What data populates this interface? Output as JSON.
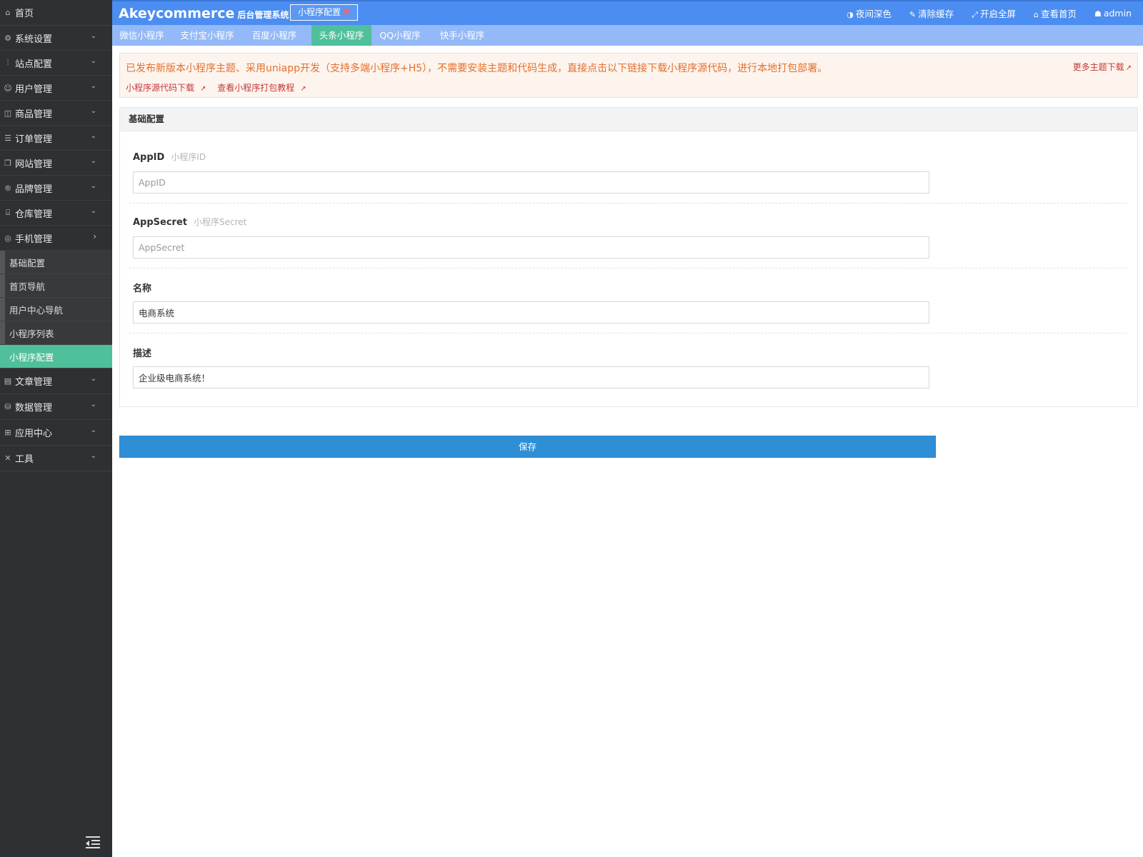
{
  "header": {
    "brand": "Akeycommerce",
    "brand_sub": "后台管理系统",
    "open_tab": "小程序配置",
    "tools": {
      "night": "夜间深色",
      "clear_cache": "清除缓存",
      "fullscreen": "开启全屏",
      "view_home": "查看首页",
      "user": "admin"
    }
  },
  "sidebar": {
    "home": "首页",
    "menu": [
      {
        "label": "系统设置",
        "icon": "gear-icon"
      },
      {
        "label": "站点配置",
        "icon": "sliders-icon"
      },
      {
        "label": "用户管理",
        "icon": "user-icon"
      },
      {
        "label": "商品管理",
        "icon": "bag-icon"
      },
      {
        "label": "订单管理",
        "icon": "list-icon"
      },
      {
        "label": "网站管理",
        "icon": "browser-icon"
      },
      {
        "label": "品牌管理",
        "icon": "registered-icon"
      },
      {
        "label": "仓库管理",
        "icon": "warehouse-icon"
      },
      {
        "label": "手机管理",
        "icon": "mobile-icon"
      }
    ],
    "submenu": [
      "基础配置",
      "首页导航",
      "用户中心导航",
      "小程序列表",
      "小程序配置"
    ],
    "menu_after": [
      {
        "label": "文章管理",
        "icon": "article-icon"
      },
      {
        "label": "数据管理",
        "icon": "database-icon"
      },
      {
        "label": "应用中心",
        "icon": "apps-icon"
      },
      {
        "label": "工具",
        "icon": "tools-icon"
      }
    ]
  },
  "subnav": {
    "tabs": [
      "微信小程序",
      "支付宝小程序",
      "百度小程序",
      "头条小程序",
      "QQ小程序",
      "快手小程序"
    ],
    "active": "头条小程序"
  },
  "notice": {
    "message": "已发布新版本小程序主题、采用uniapp开发（支持多端小程序+H5），不需要安装主题和代码生成，直接点击以下链接下载小程序源代码，进行本地打包部署。",
    "link_download": "小程序源代码下载",
    "link_tutorial": "查看小程序打包教程",
    "more": "更多主题下载"
  },
  "form": {
    "section_title": "基础配置",
    "appid": {
      "label": "AppID",
      "hint": "小程序ID",
      "placeholder": "AppID",
      "value": ""
    },
    "appsecret": {
      "label": "AppSecret",
      "hint": "小程序Secret",
      "placeholder": "AppSecret",
      "value": ""
    },
    "name": {
      "label": "名称",
      "value": "电商系统"
    },
    "desc": {
      "label": "描述",
      "value": "企业级电商系统！"
    },
    "save": "保存"
  },
  "colors": {
    "header": "#4b8df0",
    "subnav": "#93b9f8",
    "active_green": "#50bf9b",
    "sidebar": "#2f3033",
    "save_button": "#2f8fd6",
    "notice_text": "#e2702c"
  }
}
